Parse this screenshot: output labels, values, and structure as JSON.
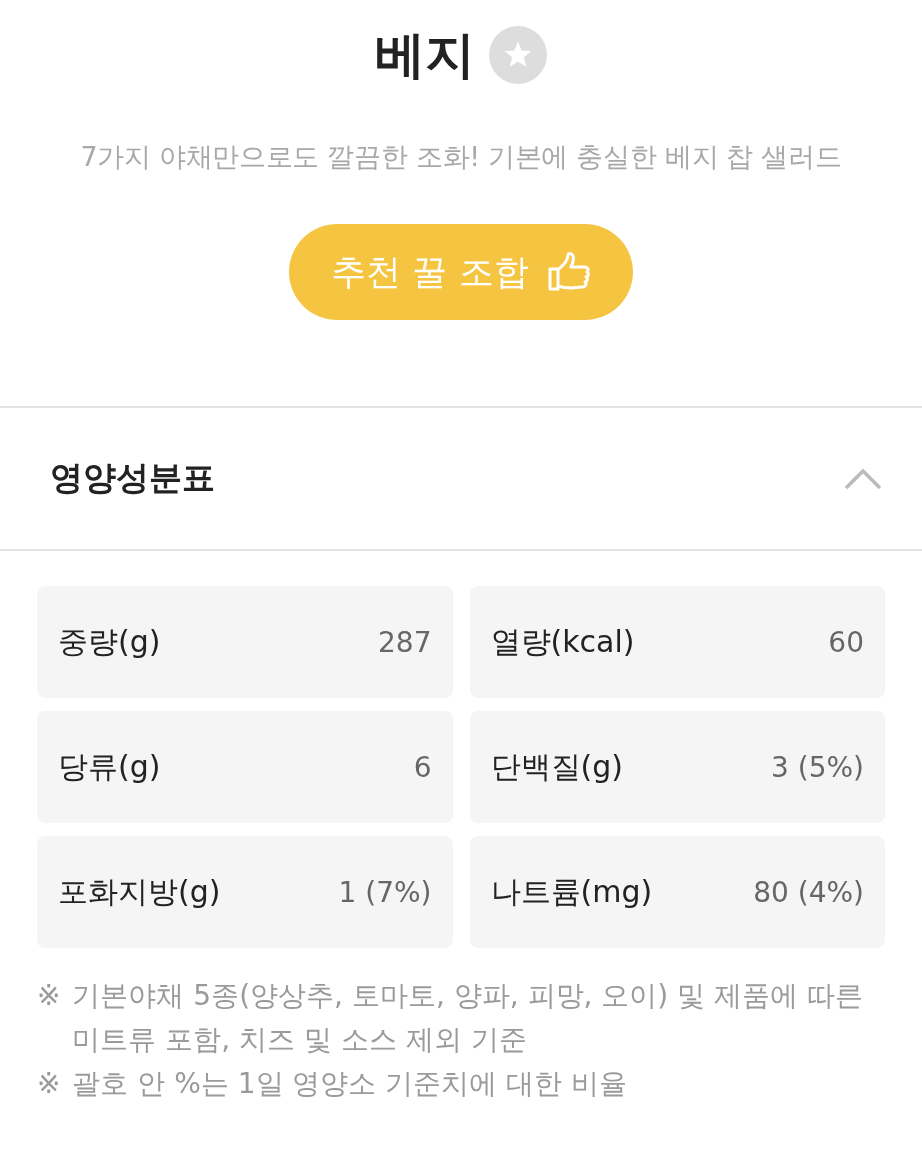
{
  "header": {
    "title": "베지",
    "favorited": false,
    "subtitle": "7가지 야채만으로도 깔끔한 조화! 기본에 충실한 베지 찹 샐러드",
    "button": {
      "label": "추천 꿀 조합"
    }
  },
  "nutrition": {
    "title": "영양성분표",
    "expanded": true,
    "items": [
      {
        "label": "중량(g)",
        "value": "287"
      },
      {
        "label": "열량(kcal)",
        "value": "60"
      },
      {
        "label": "당류(g)",
        "value": "6"
      },
      {
        "label": "단백질(g)",
        "value": "3 (5%)"
      },
      {
        "label": "포화지방(g)",
        "value": "1 (7%)"
      },
      {
        "label": "나트륨(mg)",
        "value": "80 (4%)"
      }
    ],
    "notes": [
      {
        "mark": "※",
        "text": "기본야채 5종(양상추, 토마토, 양파, 피망, 오이) 및 제품에 따른 미트류 포함, 치즈 및 소스 제외 기준"
      },
      {
        "mark": "※",
        "text": "괄호 안 %는 1일 영양소 기준치에 대한 비율"
      }
    ]
  }
}
